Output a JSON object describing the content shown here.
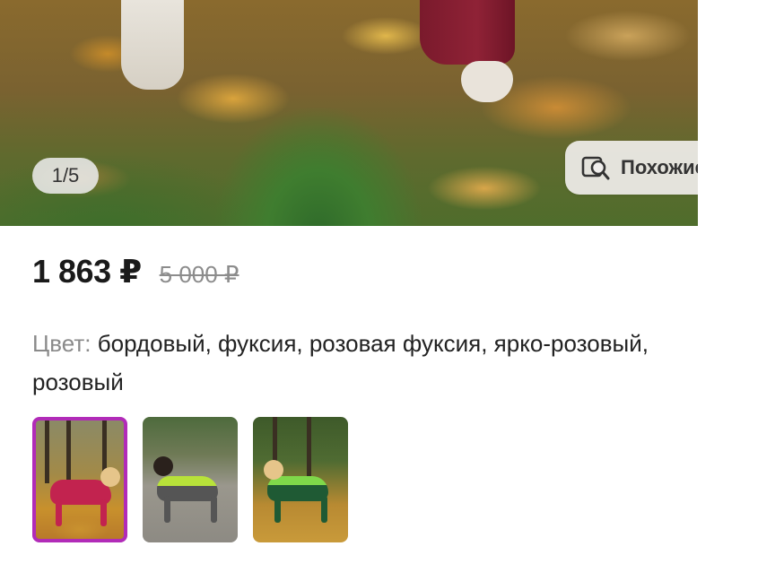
{
  "gallery": {
    "counter": "1/5",
    "similar_label": "Похожие",
    "similar_icon": "search-similar-icon"
  },
  "price": {
    "current": "1 863 ₽",
    "old": "5 000 ₽"
  },
  "color": {
    "key": "Цвет:",
    "value": "бордовый, фуксия, розовая фуксия, ярко-розовый, розовый"
  },
  "variants": {
    "selected_index": 0,
    "accent_color": "#b12bb8",
    "items": [
      {
        "icon": "dog-pink-suit-thumbnail"
      },
      {
        "icon": "dog-grey-suit-thumbnail"
      },
      {
        "icon": "dog-green-suit-thumbnail"
      }
    ]
  }
}
